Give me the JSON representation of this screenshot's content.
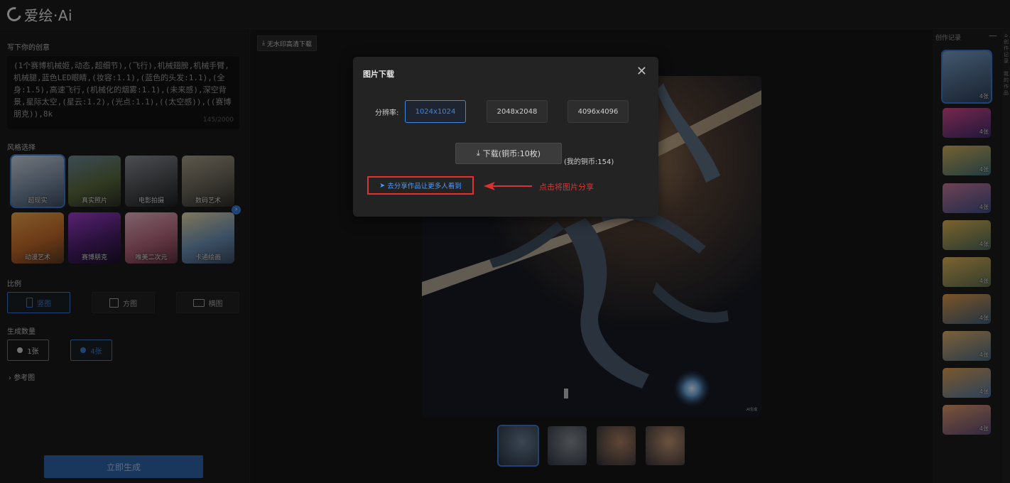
{
  "app": {
    "logo_text": "爱绘·Ai"
  },
  "left": {
    "prompt_label": "写下你的创意",
    "prompt_text": "(1个赛博机械姬,动态,超细节),(飞行),机械翅膀,机械手臂,机械腿,蓝色LED眼睛,(妆容:1.1),(蓝色的头发:1.1),(全身:1.5),高速飞行,(机械化的烟雾:1.1),(未来感),深空背景,星际太空,(星云:1.2),(光点:1.1),((太空感)),((赛博朋克)),8k",
    "prompt_count": "145/2000",
    "style_label": "风格选择",
    "styles": [
      {
        "label": "超现实",
        "colors": [
          "#cfd8e3",
          "#7d8fa6",
          "#3d4d63"
        ]
      },
      {
        "label": "真实照片",
        "colors": [
          "#6f8a9c",
          "#5b6b3f",
          "#2c2c26"
        ]
      },
      {
        "label": "电影拍摄",
        "colors": [
          "#8a8f96",
          "#4d4f53",
          "#1e1f22"
        ]
      },
      {
        "label": "数码艺术",
        "colors": [
          "#a7a08c",
          "#6b665a",
          "#2d2b27"
        ]
      },
      {
        "label": "动漫艺术",
        "colors": [
          "#f0a64c",
          "#c46a2b",
          "#5a3a22"
        ]
      },
      {
        "label": "赛博朋克",
        "colors": [
          "#a13fd0",
          "#4c1f6e",
          "#1b0f2a"
        ]
      },
      {
        "label": "唯美二次元",
        "colors": [
          "#e9b4c6",
          "#b4667d",
          "#5b2f3d"
        ]
      },
      {
        "label": "卡通绘画",
        "colors": [
          "#e8d9a8",
          "#6e93b8",
          "#3a4a63"
        ]
      }
    ],
    "ratio_label": "比例",
    "ratios": [
      "竖图",
      "方图",
      "横图"
    ],
    "count_label": "生成数量",
    "counts": [
      "1张",
      "4张"
    ],
    "ref_label": "参考图",
    "generate_label": "立即生成"
  },
  "center": {
    "download_no_watermark": "无水印高清下载",
    "image_watermark": "AI生成"
  },
  "history": {
    "title": "创作记录",
    "badge": "4张",
    "count": 10
  },
  "edge_text": "创作记录\n我的作品",
  "modal": {
    "title": "图片下载",
    "resolution_label": "分辨率:",
    "resolutions": [
      "1024x1024",
      "2048x2048",
      "4096x4096"
    ],
    "download_label": "下载(铜币:10枚)",
    "coin_info": "(我的铜币:154)",
    "share_label": "去分享作品让更多人看到",
    "annotation": "点击将图片分享"
  },
  "colors": {
    "accent": "#3a7bd5",
    "annotation": "#e03131",
    "link": "#4c9bff"
  }
}
